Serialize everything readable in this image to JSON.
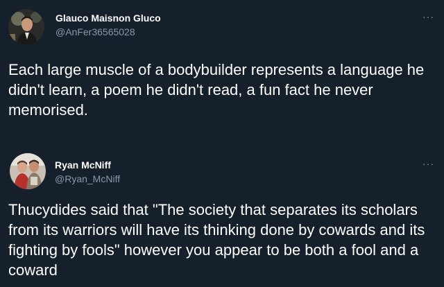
{
  "tweets": [
    {
      "display_name": "Glauco Maisnon Gluco",
      "handle": "@AnFer36565028",
      "more_label": "···",
      "avatar_icon": "user-avatar",
      "text": "Each large muscle of a bodybuilder represents a language he didn't learn, a poem he didn't read, a fun fact he never memorised."
    },
    {
      "display_name": "Ryan McNiff",
      "handle": "@Ryan_McNiff",
      "more_label": "···",
      "avatar_icon": "user-avatar",
      "text": "Thucydides said that \"The society that separates its scholars from its warriors will have its thinking done by cowards and its fighting by fools\" however you appear to be both a fool and a coward"
    }
  ],
  "colors": {
    "background": "#15202b",
    "primary_text": "#ffffff",
    "secondary_text": "#8b98a5"
  }
}
